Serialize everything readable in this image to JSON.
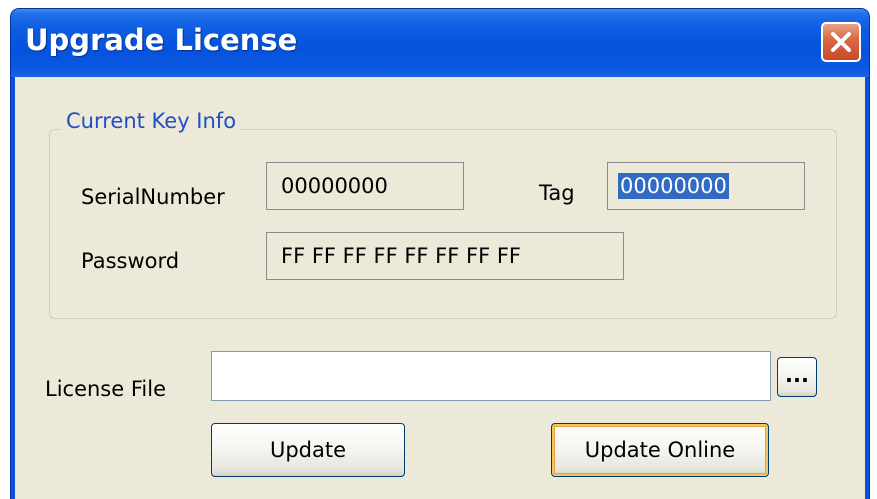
{
  "window": {
    "title": "Upgrade License",
    "close_icon": "close-icon"
  },
  "current_key_info": {
    "group_title": "Current Key Info",
    "serial_number_label": "SerialNumber",
    "serial_number_value": "00000000",
    "tag_label": "Tag",
    "tag_value": "00000000",
    "password_label": "Password",
    "password_value": "FF FF FF FF FF FF FF FF"
  },
  "license": {
    "label": "License File",
    "value": "",
    "browse_label": "..."
  },
  "buttons": {
    "update_label": "Update",
    "update_online_label": "Update Online"
  },
  "colors": {
    "titlebar": "#0a58e0",
    "client": "#ece9d8",
    "group_title": "#1f4fc7",
    "selection": "#316ac5",
    "close_button": "#d96a48",
    "default_button_highlight": "#f4c460"
  }
}
